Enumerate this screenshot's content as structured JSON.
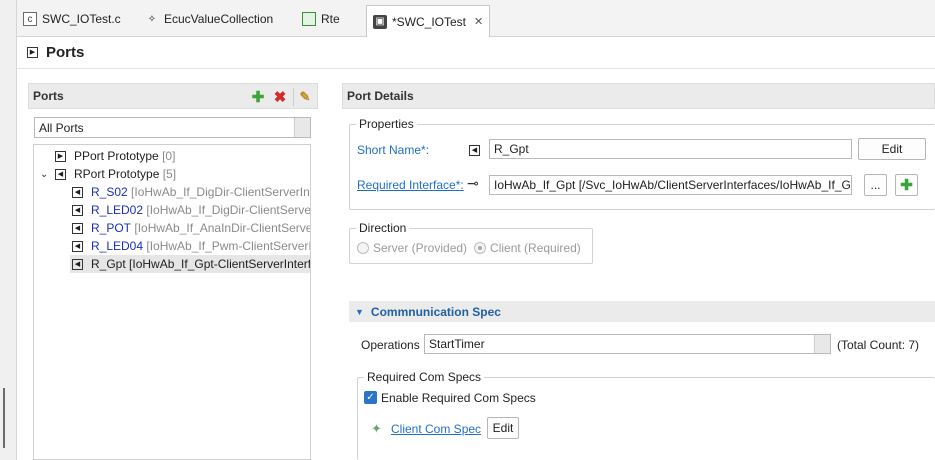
{
  "tabs": [
    {
      "label": "SWC_IOTest.c",
      "icon": "c-file-icon"
    },
    {
      "label": "EcucValueCollection",
      "icon": "ecuc-icon"
    },
    {
      "label": "Rte",
      "icon": "rte-icon"
    },
    {
      "label": "*SWC_IOTest",
      "icon": "swc-icon",
      "active": true
    }
  ],
  "page": {
    "title": "Ports"
  },
  "ports_panel": {
    "title": "Ports",
    "filter_value": "All Ports",
    "tree": [
      {
        "label": "PPort Prototype",
        "count": "[0]"
      },
      {
        "label": "RPort Prototype",
        "count": "[5]",
        "expanded": true
      },
      {
        "name": "R_S02",
        "detail": "[IoHwAb_If_DigDir-ClientServerInt"
      },
      {
        "name": "R_LED02",
        "detail": "[IoHwAb_If_DigDir-ClientServer"
      },
      {
        "name": "R_POT",
        "detail": "[IoHwAb_If_AnaInDir-ClientServer"
      },
      {
        "name": "R_LED04",
        "detail": "[IoHwAb_If_Pwm-ClientServerIn"
      },
      {
        "name": "R_Gpt",
        "detail": "[IoHwAb_If_Gpt-ClientServerInterfa",
        "selected": true
      }
    ]
  },
  "port_details": {
    "title": "Port Details",
    "properties": {
      "legend": "Properties",
      "short_name_label": "Short Name*:",
      "short_name_value": "R_Gpt",
      "edit_label": "Edit",
      "required_interface_label": "Required Interface*:",
      "required_interface_value": "IoHwAb_If_Gpt [/Svc_IoHwAb/ClientServerInterfaces/IoHwAb_If_Gpt",
      "browse_label": "..."
    },
    "direction": {
      "legend": "Direction",
      "options": [
        "Server (Provided)",
        "Client (Required)"
      ],
      "selected": "Client (Required)"
    },
    "comm_spec": {
      "title": "Commnunication Spec",
      "operations_label": "Operations",
      "operations_value": "StartTimer",
      "total_count": "(Total Count: 7)",
      "required_com_specs": {
        "legend": "Required Com Specs",
        "enable_label": "Enable Required Com Specs",
        "enable_checked": true,
        "client_com_spec_link": "Client Com Spec",
        "edit_label": "Edit"
      }
    }
  }
}
